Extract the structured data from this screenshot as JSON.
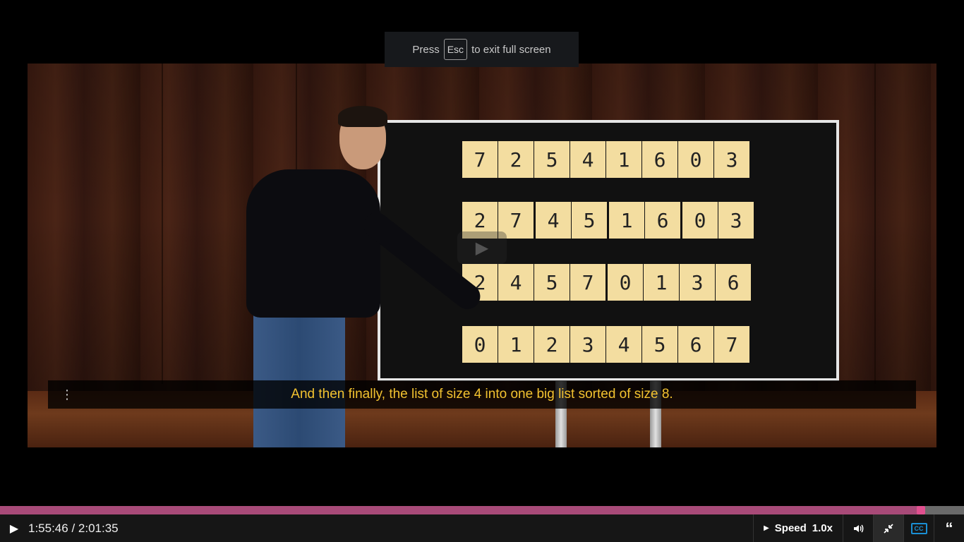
{
  "fullscreen_notice": {
    "prefix": "Press",
    "key": "Esc",
    "suffix": "to exit full screen"
  },
  "board": {
    "rows": [
      [
        "7",
        "2",
        "5",
        "4",
        "1",
        "6",
        "0",
        "3"
      ],
      [
        "2",
        "7",
        "4",
        "5",
        "1",
        "6",
        "0",
        "3"
      ],
      [
        "2",
        "4",
        "5",
        "7",
        "0",
        "1",
        "3",
        "6"
      ],
      [
        "0",
        "1",
        "2",
        "3",
        "4",
        "5",
        "6",
        "7"
      ]
    ]
  },
  "caption": {
    "text": "And then finally, the list of size 4 into one big list sorted of size 8."
  },
  "progress": {
    "fraction": 0.955
  },
  "controls": {
    "time": "1:55:46 / 2:01:35",
    "speed_label": "Speed",
    "speed_value": "1.0x"
  },
  "icons": {
    "play": "play-icon",
    "volume": "volume-icon",
    "exit_fullscreen": "exit-fullscreen-icon",
    "cc": "closed-captions-icon",
    "transcript": "transcript-quote-icon",
    "caption_menu": "vertical-dots-icon"
  },
  "colors": {
    "progress_fill": "#a84a78",
    "progress_handle": "#e0508f",
    "caption_text": "#f2c230",
    "cc_active": "#1a8fd4"
  }
}
